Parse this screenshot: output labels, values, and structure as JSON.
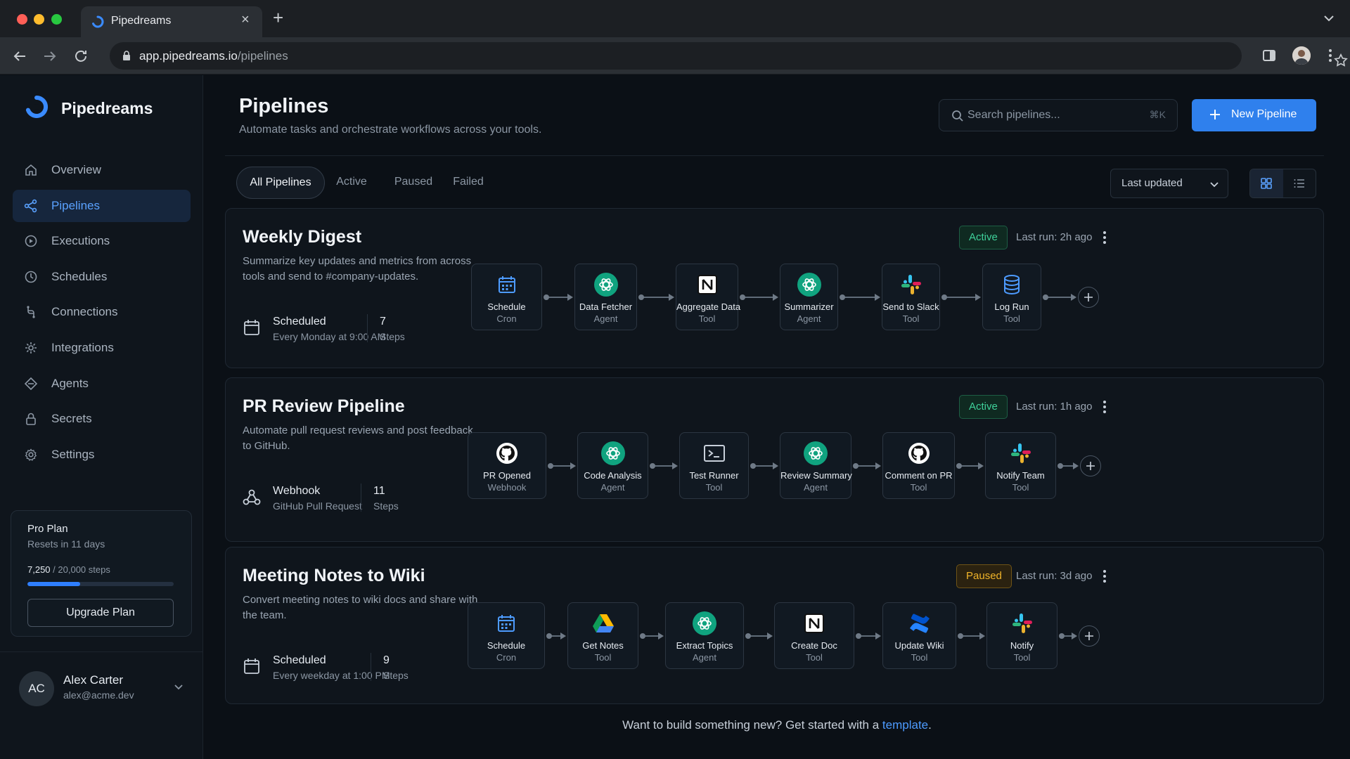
{
  "browser": {
    "tab_title": "Pipedreams",
    "url_host": "app.pipedreams.io",
    "url_path": "/pipelines"
  },
  "sidebar": {
    "brand": "Pipedreams",
    "items": [
      {
        "label": "Overview",
        "icon": "home-icon",
        "active": false
      },
      {
        "label": "Pipelines",
        "icon": "pipelines-icon",
        "active": true
      },
      {
        "label": "Executions",
        "icon": "executions-icon",
        "active": false
      },
      {
        "label": "Schedules",
        "icon": "clock-icon",
        "active": false
      },
      {
        "label": "Connections",
        "icon": "connections-icon",
        "active": false
      },
      {
        "label": "Integrations",
        "icon": "integrations-icon",
        "active": false
      },
      {
        "label": "Agents",
        "icon": "agents-icon",
        "active": false
      },
      {
        "label": "Secrets",
        "icon": "lock-icon",
        "active": false
      },
      {
        "label": "Settings",
        "icon": "gear-icon",
        "active": false
      }
    ],
    "plan": {
      "name": "Pro Plan",
      "reset": "Resets in 11 days",
      "used": "7,250",
      "total": "/ 20,000 steps",
      "usage_fraction": 0.3625,
      "upgrade_label": "Upgrade Plan"
    },
    "user": {
      "initials": "AC",
      "name": "Alex Carter",
      "email": "alex@acme.dev"
    }
  },
  "header": {
    "title": "Pipelines",
    "subtitle": "Automate tasks and orchestrate workflows across your tools.",
    "search_placeholder": "Search pipelines...",
    "search_shortcut": "⌘K",
    "new_button": "New Pipeline"
  },
  "filters": {
    "tabs": [
      "All Pipelines",
      "Active",
      "Paused",
      "Failed"
    ],
    "active_tab": "All Pipelines",
    "sort_label": "Last updated",
    "view": "grid"
  },
  "pipelines": [
    {
      "title": "Weekly Digest",
      "description": "Summarize key updates and metrics from across tools and send to #company-updates.",
      "trigger_icon": "calendar-icon",
      "trigger_name": "Scheduled",
      "trigger_detail": "Every Monday at 9:00 AM",
      "steps_count": "7",
      "steps_label": "Steps",
      "status": "Active",
      "last_run": "Last run:  2h ago",
      "nodes": [
        {
          "name": "Schedule",
          "type": "Cron",
          "icon": "calendar-icon"
        },
        {
          "name": "Data Fetcher",
          "type": "Agent",
          "icon": "openai-icon"
        },
        {
          "name": "Aggregate Data",
          "type": "Tool",
          "icon": "notion-icon"
        },
        {
          "name": "Summarizer",
          "type": "Agent",
          "icon": "openai-icon"
        },
        {
          "name": "Send to Slack",
          "type": "Tool",
          "icon": "slack-icon"
        },
        {
          "name": "Log Run",
          "type": "Tool",
          "icon": "database-icon"
        }
      ]
    },
    {
      "title": "PR Review Pipeline",
      "description": "Automate pull request reviews and post feedback to GitHub.",
      "trigger_icon": "webhook-icon",
      "trigger_name": "Webhook",
      "trigger_detail": "GitHub Pull Request",
      "steps_count": "11",
      "steps_label": "Steps",
      "status": "Active",
      "last_run": "Last run:  1h ago",
      "nodes": [
        {
          "name": "PR Opened",
          "type": "Webhook",
          "icon": "github-icon"
        },
        {
          "name": "Code Analysis",
          "type": "Agent",
          "icon": "openai-icon"
        },
        {
          "name": "Test Runner",
          "type": "Tool",
          "icon": "terminal-icon"
        },
        {
          "name": "Review Summary",
          "type": "Agent",
          "icon": "openai-icon"
        },
        {
          "name": "Comment on PR",
          "type": "Tool",
          "icon": "github-icon"
        },
        {
          "name": "Notify Team",
          "type": "Tool",
          "icon": "slack-icon"
        }
      ]
    },
    {
      "title": "Meeting Notes to Wiki",
      "description": "Convert meeting notes to wiki docs and share with the team.",
      "trigger_icon": "calendar-icon",
      "trigger_name": "Scheduled",
      "trigger_detail": "Every weekday at 1:00 PM",
      "steps_count": "9",
      "steps_label": "Steps",
      "status": "Paused",
      "last_run": "Last run:  3d ago",
      "nodes": [
        {
          "name": "Schedule",
          "type": "Cron",
          "icon": "calendar-icon"
        },
        {
          "name": "Get Notes",
          "type": "Tool",
          "icon": "google-drive-icon"
        },
        {
          "name": "Extract Topics",
          "type": "Agent",
          "icon": "openai-icon"
        },
        {
          "name": "Create Doc",
          "type": "Tool",
          "icon": "notion-icon"
        },
        {
          "name": "Update Wiki",
          "type": "Tool",
          "icon": "confluence-icon"
        },
        {
          "name": "Notify",
          "type": "Tool",
          "icon": "slack-icon"
        }
      ]
    }
  ],
  "footer": {
    "text": "Want to build something new? Get started with a ",
    "link": "template",
    "end": "."
  },
  "colors": {
    "accent": "#2f80ed",
    "active_status": "#3fd19a",
    "paused_status": "#f0b429",
    "background": "#0b1016"
  }
}
